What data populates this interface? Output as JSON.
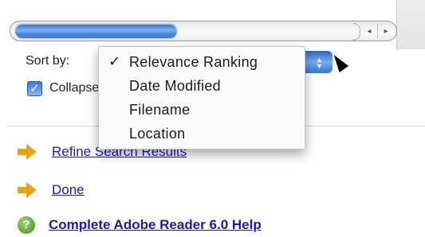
{
  "colors": {
    "link": "#1a17c8",
    "accent": "#3a73d2",
    "arrow_bullet": "#e6a312"
  },
  "scrollbar": {
    "left_arrow_icon": "◂",
    "right_arrow_icon": "▸"
  },
  "sort": {
    "label": "Sort by:",
    "popup_arrows": "▲▼"
  },
  "collapse": {
    "label": "Collapse",
    "checked": true,
    "check_glyph": "✓"
  },
  "sort_menu": {
    "items": [
      {
        "label": "Relevance Ranking",
        "check": "✓",
        "selected": true
      },
      {
        "label": "Date Modified",
        "check": "",
        "selected": false
      },
      {
        "label": "Filename",
        "check": "",
        "selected": false
      },
      {
        "label": "Location",
        "check": "",
        "selected": false
      }
    ]
  },
  "links": [
    {
      "label": "Refine Search Results",
      "icon": "arrow-icon"
    },
    {
      "label": "Done",
      "icon": "arrow-icon"
    },
    {
      "label": "Complete Adobe Reader 6.0 Help",
      "icon": "help-icon",
      "help_glyph": "?"
    }
  ]
}
